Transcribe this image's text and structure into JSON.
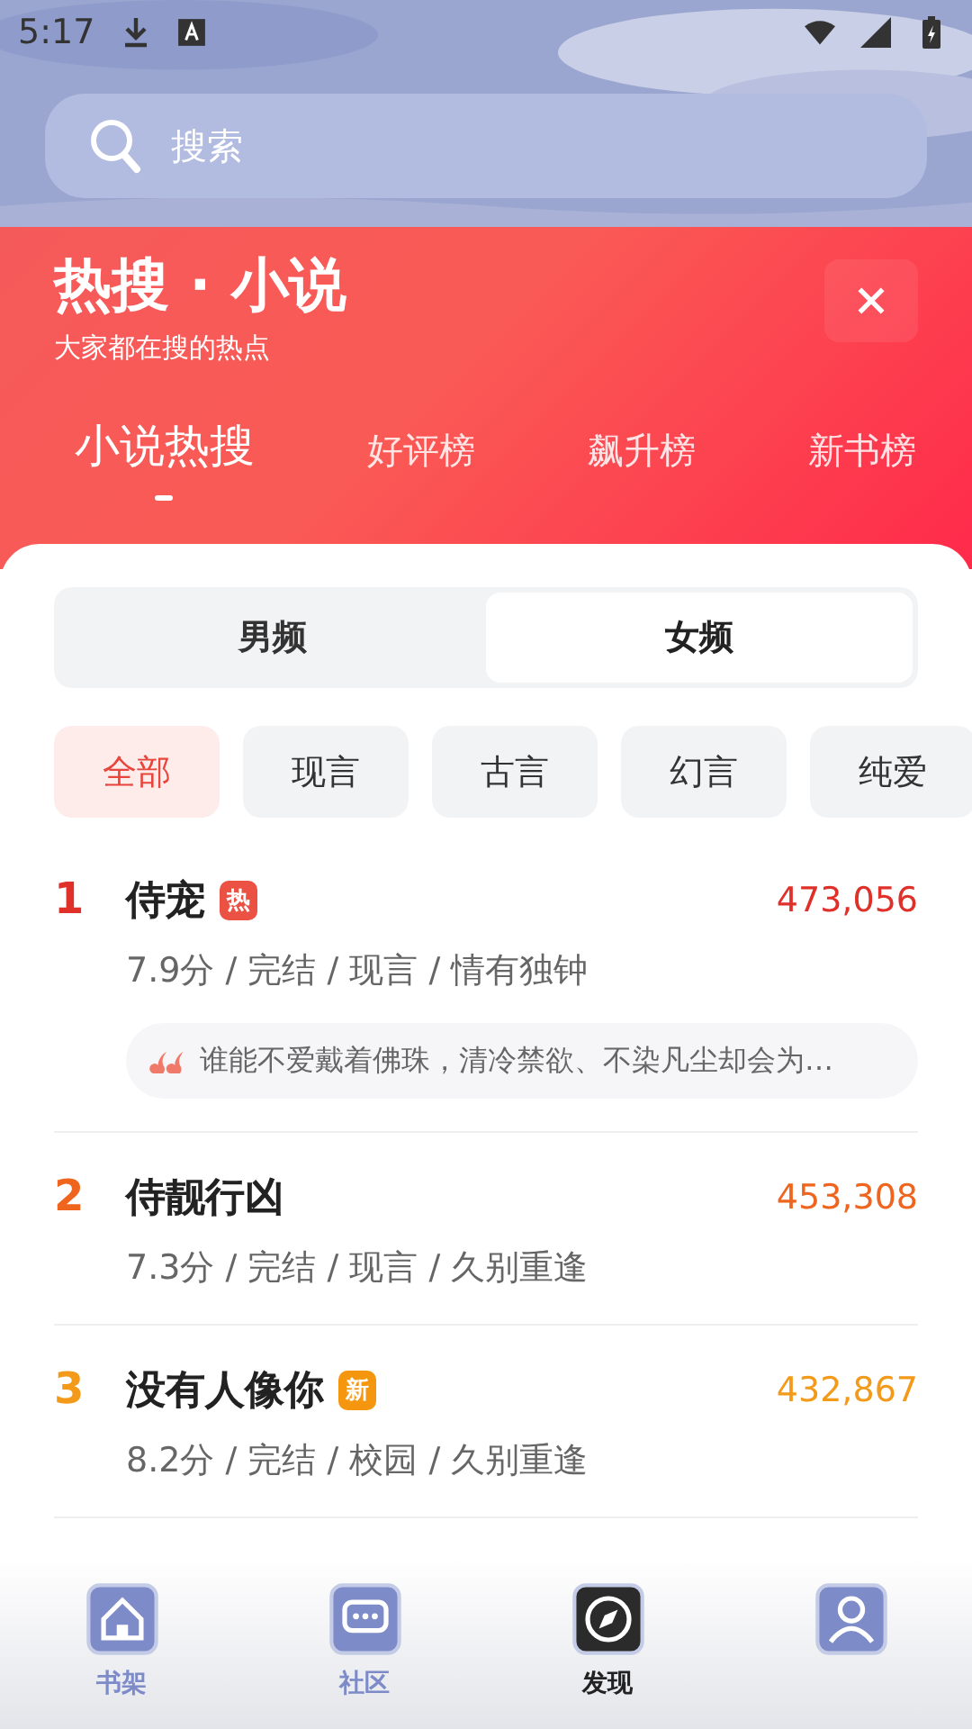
{
  "status_bar": {
    "time": "5:17"
  },
  "search": {
    "placeholder": "搜索"
  },
  "header": {
    "title": "热搜 · 小说",
    "subtitle": "大家都在搜的热点"
  },
  "tabs": [
    {
      "label": "小说热搜",
      "selected": true
    },
    {
      "label": "好评榜",
      "selected": false
    },
    {
      "label": "飙升榜",
      "selected": false
    },
    {
      "label": "新书榜",
      "selected": false
    }
  ],
  "gender_tabs": [
    {
      "label": "男频",
      "selected": false
    },
    {
      "label": "女频",
      "selected": true
    }
  ],
  "chips": [
    {
      "label": "全部",
      "selected": true
    },
    {
      "label": "现言",
      "selected": false
    },
    {
      "label": "古言",
      "selected": false
    },
    {
      "label": "幻言",
      "selected": false
    },
    {
      "label": "纯爱",
      "selected": false
    }
  ],
  "books": [
    {
      "rank": "1",
      "color": "#e0302a",
      "title": "侍宠",
      "badge": {
        "text": "热",
        "kind": "hot"
      },
      "meta": "7.9分 / 完结 / 现言 / 情有独钟",
      "count": "473,056",
      "quote": "谁能不爱戴着佛珠，清冷禁欲、不染凡尘却会为…"
    },
    {
      "rank": "2",
      "color": "#f0651e",
      "title": "侍靓行凶",
      "meta": "7.3分 / 完结 / 现言 / 久别重逢",
      "count": "453,308"
    },
    {
      "rank": "3",
      "color": "#f39a1a",
      "title": "没有人像你",
      "badge": {
        "text": "新",
        "kind": "new"
      },
      "meta": "8.2分 / 完结 / 校园 / 久别重逢",
      "count": "432,867"
    }
  ],
  "nav": [
    {
      "kind": "home",
      "label": "书架",
      "selected": false
    },
    {
      "kind": "chat",
      "label": "社区",
      "selected": false
    },
    {
      "kind": "compass",
      "label": "发现",
      "selected": true
    },
    {
      "kind": "person",
      "selected": false
    }
  ]
}
